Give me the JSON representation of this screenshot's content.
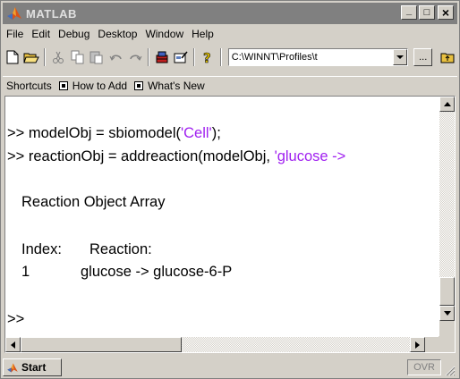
{
  "window": {
    "title": "MATLAB",
    "minimize": "_",
    "maximize": "□",
    "close": "×"
  },
  "menu": [
    "File",
    "Edit",
    "Debug",
    "Desktop",
    "Window",
    "Help"
  ],
  "toolbar": {
    "current_directory": "C:\\WINNT\\Profiles\\t",
    "browse_label": "...",
    "icons": [
      "new-file-icon",
      "open-folder-icon",
      "cut-icon",
      "copy-icon",
      "paste-icon",
      "undo-icon",
      "redo-icon",
      "simulink-icon",
      "guide-icon",
      "help-icon",
      "parent-folder-icon"
    ]
  },
  "shortcuts": {
    "label": "Shortcuts",
    "items": [
      "How to Add",
      "What's New"
    ]
  },
  "command_window": {
    "lines": [
      {
        "prompt": ">> ",
        "code": "modelObj = sbiomodel(",
        "str": "'Cell'",
        "after": ");"
      },
      {
        "prompt": ">> ",
        "code": "reactionObj = addreaction(modelObj, ",
        "str": "'glucose ->",
        "after": ""
      }
    ],
    "output_title": "Reaction Object Array",
    "table_header_index": "Index:",
    "table_header_reaction": "Reaction:",
    "rows": [
      {
        "index": "1",
        "reaction": "glucose -> glucose-6-P"
      }
    ],
    "final_prompt": ">>"
  },
  "status": {
    "start_label": "Start",
    "ovr_label": "OVR"
  },
  "colors": {
    "string": "#a020f0",
    "face": "#d4d0c8",
    "titlebar_inactive": "#808080"
  }
}
